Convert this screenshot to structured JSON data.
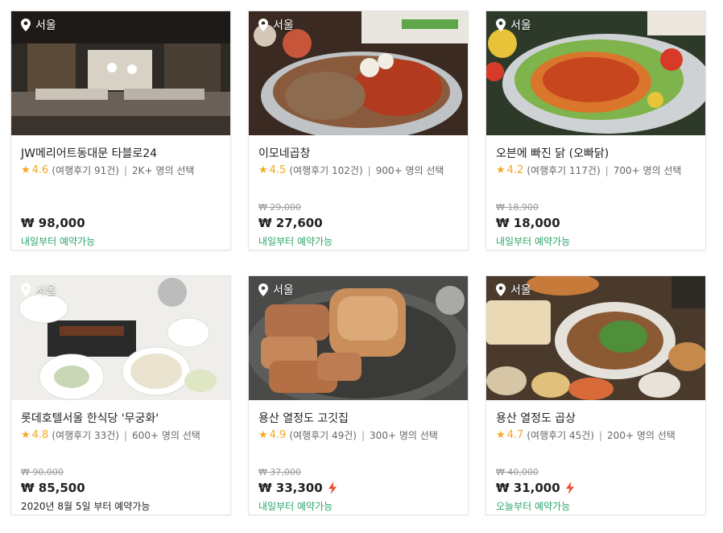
{
  "cards": [
    {
      "location": "서울",
      "title": "JW메리어트동대문 타블로24",
      "rating": "4.6",
      "reviews": "(여행후기 91건)",
      "chosen": "2K+ 명의 선택",
      "original_price": "",
      "price": "₩ 98,000",
      "availability": "내일부터 예약가능",
      "instant_icon": false
    },
    {
      "location": "서울",
      "title": "이모네곱창",
      "rating": "4.5",
      "reviews": "(여행후기 102건)",
      "chosen": "900+ 명의 선택",
      "original_price": "₩ 29,000",
      "price": "₩ 27,600",
      "availability": "내일부터 예약가능",
      "instant_icon": false
    },
    {
      "location": "서울",
      "title": "오븐에 빠진 닭 (오빠닭)",
      "rating": "4.2",
      "reviews": "(여행후기 117건)",
      "chosen": "700+ 명의 선택",
      "original_price": "₩ 18,900",
      "price": "₩ 18,000",
      "availability": "내일부터 예약가능",
      "instant_icon": false
    },
    {
      "location": "서울",
      "title": "롯데호텔서울 한식당 '무궁화'",
      "rating": "4.8",
      "reviews": "(여행후기 33건)",
      "chosen": "600+ 명의 선택",
      "original_price": "₩ 90,000",
      "price": "₩ 85,500",
      "availability": "2020년 8월 5일 부터 예약가능",
      "instant_icon": false
    },
    {
      "location": "서울",
      "title": "용산 열정도 고깃집",
      "rating": "4.9",
      "reviews": "(여행후기 49건)",
      "chosen": "300+ 명의 선택",
      "original_price": "₩ 37,000",
      "price": "₩ 33,300",
      "availability": "내일부터 예약가능",
      "instant_icon": true
    },
    {
      "location": "서울",
      "title": "용산 열정도 곱상",
      "rating": "4.7",
      "reviews": "(여행후기 45건)",
      "chosen": "200+ 명의 선택",
      "original_price": "₩ 40,000",
      "price": "₩ 31,000",
      "availability": "오늘부터 예약가능",
      "instant_icon": true
    }
  ],
  "colors": {
    "star": "#f5a623",
    "availability": "#2ca56b",
    "instant": "#f04a2c",
    "strike": "#999999"
  },
  "icons": {
    "location": "location-pin-icon",
    "rating": "star-icon",
    "instant": "lightning-bolt-icon"
  }
}
